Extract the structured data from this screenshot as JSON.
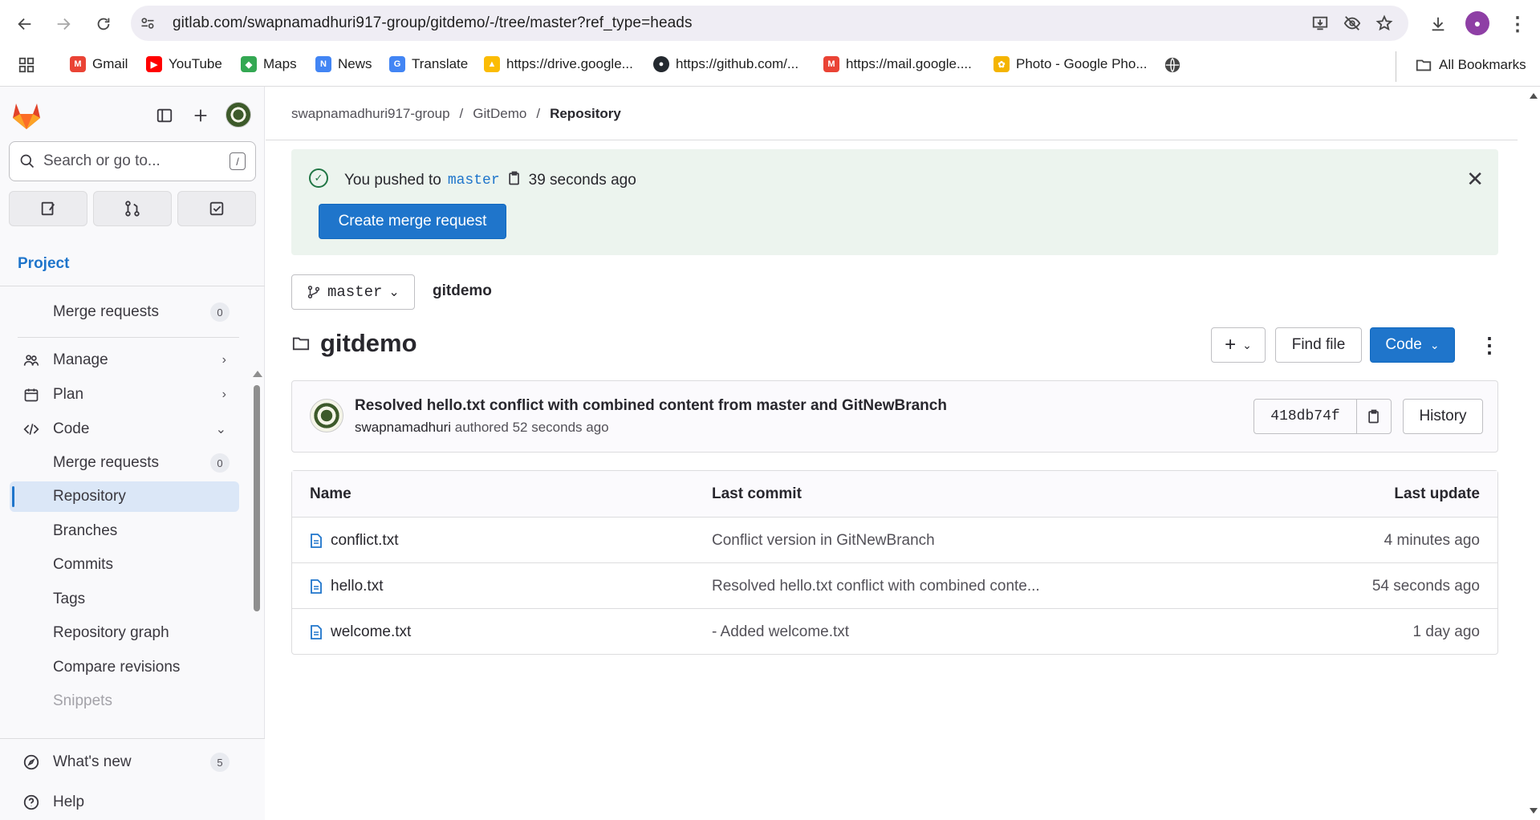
{
  "browser": {
    "url": "gitlab.com/swapnamadhuri917-group/gitdemo/-/tree/master?ref_type=heads",
    "avatar_letter": "●"
  },
  "bookmarks": [
    {
      "label": "Gmail",
      "color": "#ea4335",
      "glyph": "M"
    },
    {
      "label": "YouTube",
      "color": "#ff0000",
      "glyph": "▶"
    },
    {
      "label": "Maps",
      "color": "#34a853",
      "glyph": "◆"
    },
    {
      "label": "News",
      "color": "#4285f4",
      "glyph": "N"
    },
    {
      "label": "Translate",
      "color": "#4285f4",
      "glyph": "G"
    },
    {
      "label": "https://drive.google...",
      "color": "#fbbc04",
      "glyph": "▲"
    },
    {
      "label": "https://github.com/...",
      "color": "#24292f",
      "glyph": "●"
    },
    {
      "label": "https://mail.google....",
      "color": "#ea4335",
      "glyph": "M"
    },
    {
      "label": "Photo - Google Pho...",
      "color": "#f4b400",
      "glyph": "✿"
    }
  ],
  "all_bookmarks": "All Bookmarks",
  "sidebar": {
    "search_placeholder": "Search or go to...",
    "search_kbd": "/",
    "section_title": "Project",
    "items": [
      {
        "label": "Merge requests",
        "count": "0"
      },
      {
        "label": "Manage"
      },
      {
        "label": "Plan"
      },
      {
        "label": "Code"
      },
      {
        "label": "Merge requests",
        "count": "0"
      },
      {
        "label": "Repository"
      },
      {
        "label": "Branches"
      },
      {
        "label": "Commits"
      },
      {
        "label": "Tags"
      },
      {
        "label": "Repository graph"
      },
      {
        "label": "Compare revisions"
      },
      {
        "label": "Snippets"
      }
    ],
    "whats_new": "What's new",
    "whats_new_count": "5",
    "help": "Help"
  },
  "breadcrumb": {
    "group": "swapnamadhuri917-group",
    "project": "GitDemo",
    "current": "Repository"
  },
  "alert": {
    "prefix": "You pushed to",
    "branch": "master",
    "time": "39 seconds ago",
    "button": "Create merge request"
  },
  "repo": {
    "branch": "master",
    "path_root": "gitdemo",
    "title": "gitdemo",
    "find_file": "Find file",
    "code": "Code"
  },
  "commit": {
    "title": "Resolved hello.txt conflict with combined content from master and GitNewBranch",
    "author": "swapnamadhuri",
    "authored": "authored 52 seconds ago",
    "sha": "418db74f",
    "history": "History"
  },
  "files": {
    "headers": {
      "name": "Name",
      "last_commit": "Last commit",
      "last_update": "Last update"
    },
    "rows": [
      {
        "name": "conflict.txt",
        "commit": "Conflict version in GitNewBranch",
        "updated": "4 minutes ago"
      },
      {
        "name": "hello.txt",
        "commit": "Resolved hello.txt conflict with combined conte...",
        "updated": "54 seconds ago"
      },
      {
        "name": "welcome.txt",
        "commit": "- Added welcome.txt",
        "updated": "1 day ago"
      }
    ]
  },
  "colors": {
    "accent": "#1f75cb",
    "alert_bg": "#ecf4ee",
    "success": "#217645"
  }
}
